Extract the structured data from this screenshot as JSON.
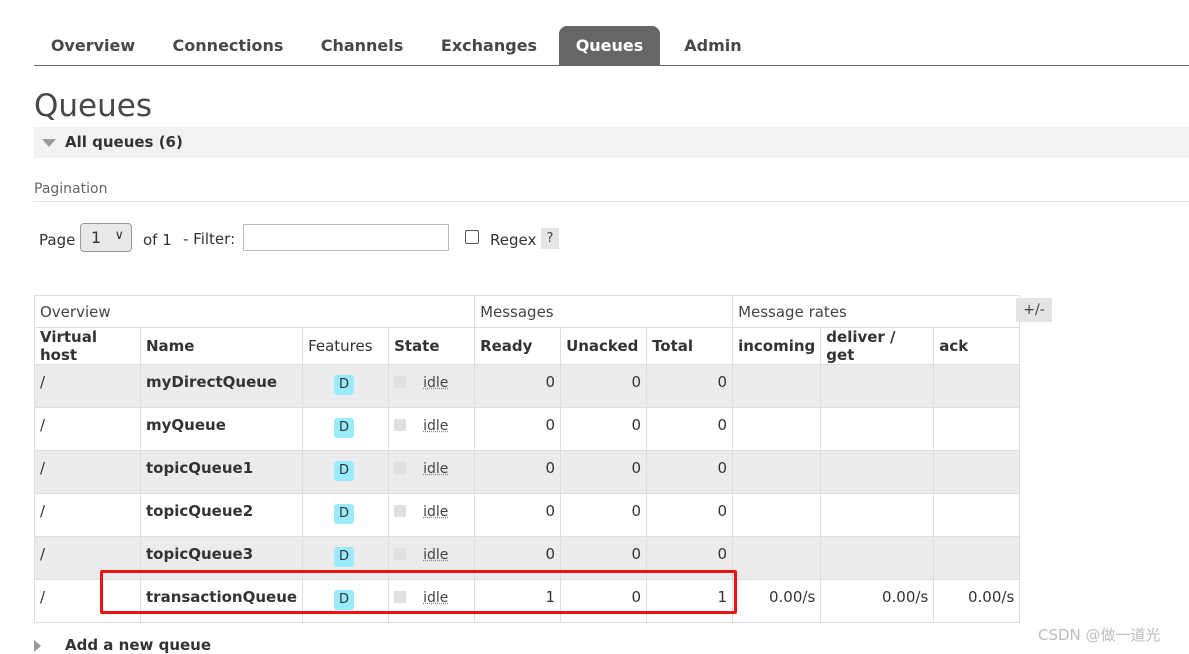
{
  "nav": {
    "tabs": [
      {
        "label": "Overview"
      },
      {
        "label": "Connections"
      },
      {
        "label": "Channels"
      },
      {
        "label": "Exchanges"
      },
      {
        "label": "Queues",
        "active": true
      },
      {
        "label": "Admin"
      }
    ]
  },
  "page": {
    "title": "Queues",
    "section_label": "All queues (6)"
  },
  "pagination": {
    "label": "Pagination",
    "page_label": "Page",
    "page_value": "1",
    "of_label": "of 1",
    "filter_label": "- Filter:",
    "filter_value": "",
    "regex_label": "Regex",
    "help_label": "?"
  },
  "table": {
    "groups": [
      "Overview",
      "Messages",
      "Message rates"
    ],
    "columns": [
      "Virtual host",
      "Name",
      "Features",
      "State",
      "Ready",
      "Unacked",
      "Total",
      "incoming",
      "deliver / get",
      "ack"
    ],
    "plus_minus": "+/-",
    "rows": [
      {
        "vhost": "/",
        "name": "myDirectQueue",
        "feature": "D",
        "state": "idle",
        "ready": "0",
        "unacked": "0",
        "total": "0",
        "incoming": "",
        "deliver": "",
        "ack": ""
      },
      {
        "vhost": "/",
        "name": "myQueue",
        "feature": "D",
        "state": "idle",
        "ready": "0",
        "unacked": "0",
        "total": "0",
        "incoming": "",
        "deliver": "",
        "ack": ""
      },
      {
        "vhost": "/",
        "name": "topicQueue1",
        "feature": "D",
        "state": "idle",
        "ready": "0",
        "unacked": "0",
        "total": "0",
        "incoming": "",
        "deliver": "",
        "ack": ""
      },
      {
        "vhost": "/",
        "name": "topicQueue2",
        "feature": "D",
        "state": "idle",
        "ready": "0",
        "unacked": "0",
        "total": "0",
        "incoming": "",
        "deliver": "",
        "ack": ""
      },
      {
        "vhost": "/",
        "name": "topicQueue3",
        "feature": "D",
        "state": "idle",
        "ready": "0",
        "unacked": "0",
        "total": "0",
        "incoming": "",
        "deliver": "",
        "ack": ""
      },
      {
        "vhost": "/",
        "name": "transactionQueue",
        "feature": "D",
        "state": "idle",
        "ready": "1",
        "unacked": "0",
        "total": "1",
        "incoming": "0.00/s",
        "deliver": "0.00/s",
        "ack": "0.00/s"
      }
    ]
  },
  "footer": {
    "add_queue_label": "Add a new queue",
    "watermark": "CSDN @做一道光"
  },
  "colors": {
    "active_tab": "#666666",
    "badge": "#99ebff",
    "highlight": "#ee1111"
  }
}
